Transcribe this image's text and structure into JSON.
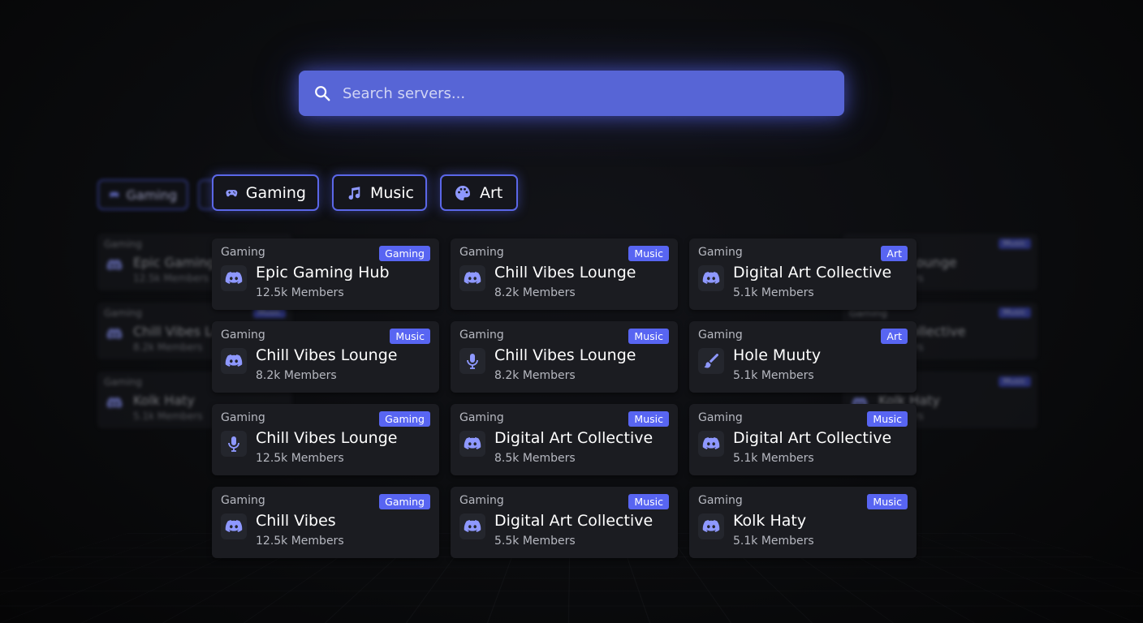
{
  "search": {
    "placeholder": "Search servers..."
  },
  "filters": [
    {
      "label": "Gaming",
      "icon": "gamepad-icon"
    },
    {
      "label": "Music",
      "icon": "music-note-icon"
    },
    {
      "label": "Art",
      "icon": "palette-icon"
    }
  ],
  "background_filter": {
    "label": "Gaming"
  },
  "cards": [
    {
      "category": "Gaming",
      "badge": "Gaming",
      "name": "Epic Gaming Hub",
      "members": "12.5k Members",
      "icon": "discord-icon"
    },
    {
      "category": "Gaming",
      "badge": "Music",
      "name": "Chill Vibes Lounge",
      "members": "8.2k Members",
      "icon": "discord-icon"
    },
    {
      "category": "Gaming",
      "badge": "Art",
      "name": "Digital Art Collective",
      "members": "5.1k Members",
      "icon": "discord-icon"
    },
    {
      "category": "Gaming",
      "badge": "Music",
      "name": "Chill Vibes Lounge",
      "members": "8.2k Members",
      "icon": "discord-icon"
    },
    {
      "category": "Gaming",
      "badge": "Music",
      "name": "Chill Vibes Lounge",
      "members": "8.2k Members",
      "icon": "microphone-icon"
    },
    {
      "category": "Gaming",
      "badge": "Art",
      "name": "Hole Muuty",
      "members": "5.1k Members",
      "icon": "brush-icon"
    },
    {
      "category": "Gaming",
      "badge": "Gaming",
      "name": "Chill Vibes Lounge",
      "members": "12.5k Members",
      "icon": "microphone-icon"
    },
    {
      "category": "Gaming",
      "badge": "Music",
      "name": "Digital Art Collective",
      "members": "8.5k Members",
      "icon": "discord-icon"
    },
    {
      "category": "Gaming",
      "badge": "Music",
      "name": "Digital Art Collective",
      "members": "5.1k Members",
      "icon": "discord-icon"
    },
    {
      "category": "Gaming",
      "badge": "Gaming",
      "name": "Chill Vibes",
      "members": "12.5k Members",
      "icon": "discord-icon"
    },
    {
      "category": "Gaming",
      "badge": "Music",
      "name": "Digital Art Collective",
      "members": "5.5k Members",
      "icon": "discord-icon"
    },
    {
      "category": "Gaming",
      "badge": "Music",
      "name": "Kolk Haty",
      "members": "5.1k Members",
      "icon": "discord-icon"
    }
  ],
  "background_cards_left": [
    {
      "category": "Gaming",
      "name": "Epic Gaming",
      "members": "12.5k Members",
      "badge": ""
    },
    {
      "category": "Gaming",
      "name": "Chill Vibes Lo",
      "members": "8.2k Members",
      "badge": "Music"
    },
    {
      "category": "Gaming",
      "name": "Kolk Haty",
      "members": "5.1k Members",
      "badge": ""
    }
  ],
  "background_cards_right": [
    {
      "category": "",
      "name": "ibes Lounge",
      "members": "Members",
      "badge": "Music"
    },
    {
      "category": "Gaming",
      "name": "Art Collective",
      "members": "Members",
      "badge": "Music"
    },
    {
      "category": "",
      "name": "Kolk Haty",
      "members": "Members",
      "badge": "Music"
    }
  ],
  "colors": {
    "accent": "#5865f2",
    "card_bg": "#1b1c21",
    "page_bg": "#0a0b0d"
  }
}
